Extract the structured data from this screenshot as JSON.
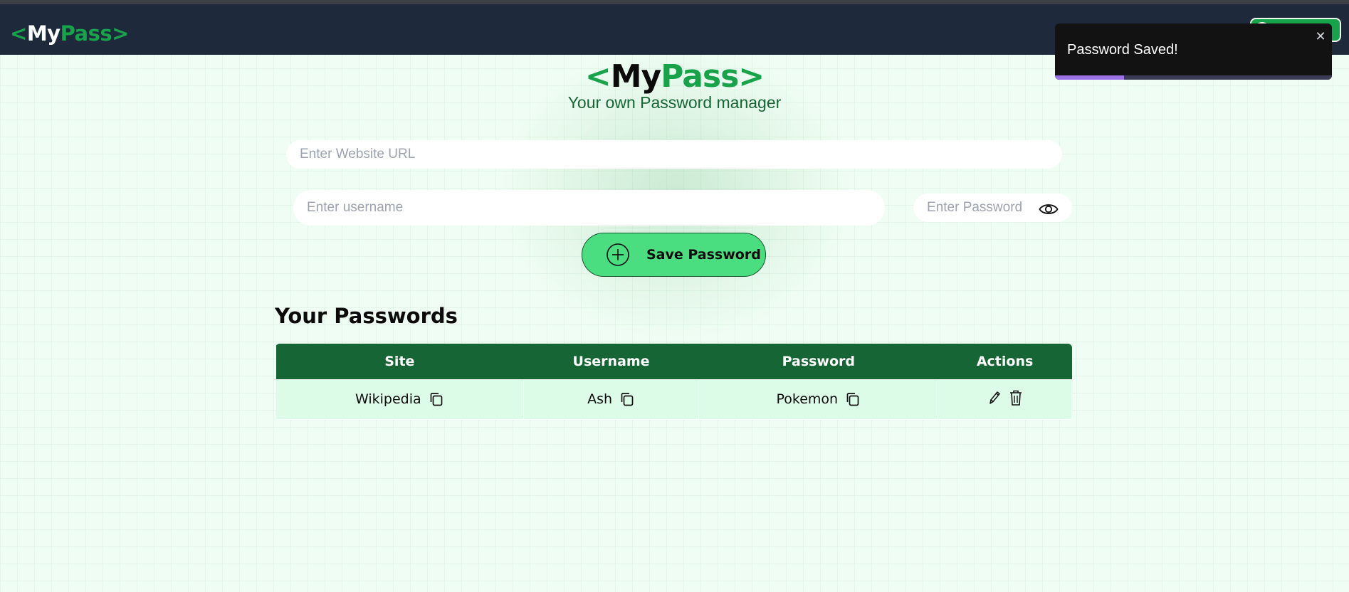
{
  "nav": {
    "logo": {
      "open": "<",
      "part1": "My",
      "part2": "Pass",
      "close": ">"
    }
  },
  "hero": {
    "brand": {
      "open": "<",
      "part1": "My",
      "part2": "Pass",
      "close": ">"
    },
    "tagline": "Your own Password manager"
  },
  "form": {
    "url_placeholder": "Enter Website URL",
    "url_value": "",
    "username_placeholder": "Enter username",
    "username_value": "",
    "password_placeholder": "Enter Password",
    "password_value": "",
    "save_label": "Save Password"
  },
  "passwords": {
    "title": "Your Passwords",
    "columns": [
      "Site",
      "Username",
      "Password",
      "Actions"
    ],
    "rows": [
      {
        "site": "Wikipedia",
        "username": "Ash",
        "password": "Pokemon"
      }
    ]
  },
  "toast": {
    "message": "Password Saved!",
    "close_glyph": "✕",
    "progress_fraction": 0.25
  },
  "colors": {
    "accent": "#16a34a",
    "nav_bg": "#1e293b",
    "table_header": "#166534",
    "table_row": "#dcfce7",
    "save_button": "#4ade80",
    "toast_bg": "#121212",
    "toast_progress": "#9b72e5"
  },
  "icons": {
    "eye": "eye-icon",
    "plus": "plus-circle-icon",
    "copy": "copy-icon",
    "edit": "pencil-icon",
    "delete": "trash-icon",
    "close": "close-icon"
  }
}
